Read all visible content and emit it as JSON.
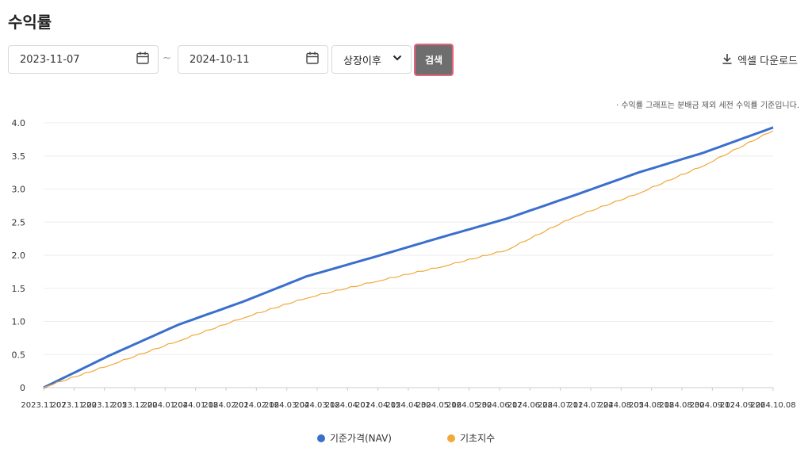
{
  "page": {
    "title": "수익률"
  },
  "filters": {
    "start_date": "2023-11-07",
    "separator": "~",
    "end_date": "2024-10-11",
    "period_select": "상장이후",
    "search_label": "검색",
    "excel_label": "엑셀 다운로드"
  },
  "note": "· 수익률 그래프는 분배금 제외 세전 수익률 기준입니다.",
  "colors": {
    "nav": "#3a6fcc",
    "index": "#f0a93a"
  },
  "chart_data": {
    "type": "line",
    "title": "",
    "xlabel": "",
    "ylabel": "",
    "ylim": [
      0,
      4.0
    ],
    "yticks": [
      "0",
      "0.5",
      "1.0",
      "1.5",
      "2.0",
      "2.5",
      "3.0",
      "3.5",
      "4.0"
    ],
    "x_ticks": [
      "2023.11.07",
      "2023.11.20",
      "2023.12.05",
      "2023.12.20",
      "2024.01.04",
      "2024.01.18",
      "2024.02.01",
      "2024.02.16",
      "2024.03.04",
      "2024.03.18",
      "2024.04.01",
      "2024.04.15",
      "2024.04.30",
      "2024.05.16",
      "2024.05.30",
      "2024.06.17",
      "2024.06.28",
      "2024.07.11",
      "2024.07.24",
      "2024.08.05",
      "2024.08.18",
      "2024.08.30",
      "2024.09.12",
      "2024.09.26",
      "2024.10.08"
    ],
    "x_range": [
      "2023-11-07",
      "2024-10-08"
    ],
    "grid": true,
    "legend": "bottom",
    "series": [
      {
        "name": "기준가격(NAV)",
        "x": [
          "2023-11-07",
          "2023-12-07",
          "2024-01-08",
          "2024-02-07",
          "2024-03-07",
          "2024-04-08",
          "2024-05-08",
          "2024-06-07",
          "2024-07-08",
          "2024-08-07",
          "2024-09-06",
          "2024-10-08"
        ],
        "values": [
          0,
          0.48,
          0.95,
          1.3,
          1.68,
          1.98,
          2.27,
          2.55,
          2.9,
          3.25,
          3.55,
          3.93
        ]
      },
      {
        "name": "기초지수",
        "x": [
          "2023-11-07",
          "2023-12-07",
          "2024-01-08",
          "2024-02-07",
          "2024-03-07",
          "2024-04-08",
          "2024-05-08",
          "2024-06-07",
          "2024-07-08",
          "2024-08-07",
          "2024-09-06",
          "2024-10-08"
        ],
        "values": [
          0,
          0.33,
          0.7,
          1.05,
          1.35,
          1.6,
          1.82,
          2.07,
          2.57,
          2.93,
          3.35,
          3.88
        ]
      }
    ]
  },
  "legend": {
    "nav": "기준가격(NAV)",
    "index": "기초지수"
  }
}
